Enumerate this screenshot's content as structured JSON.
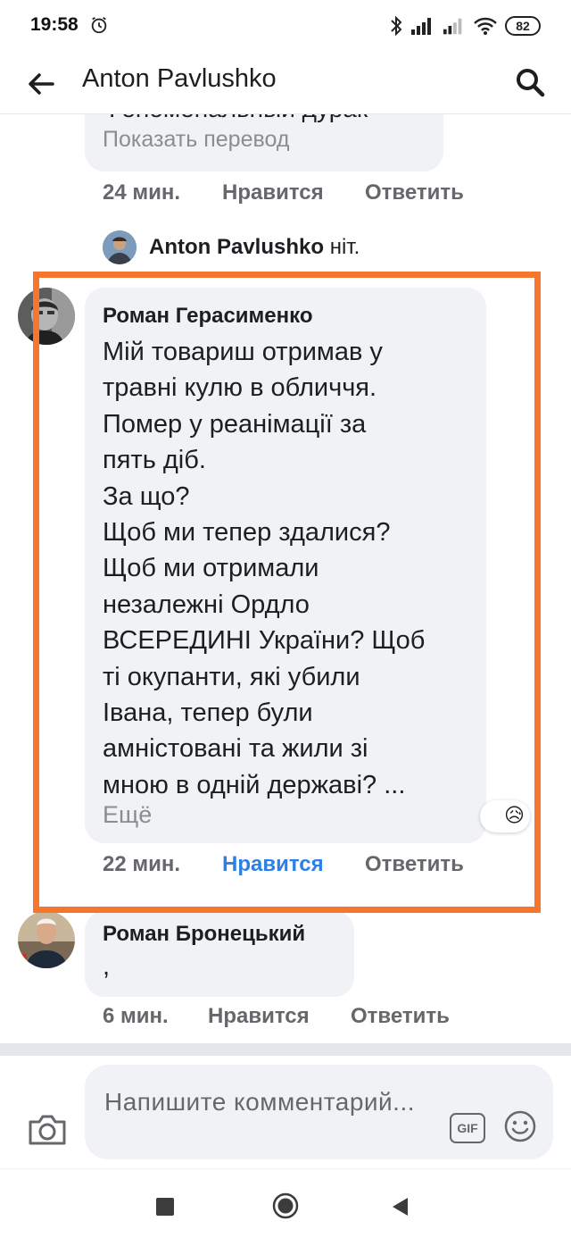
{
  "status_bar": {
    "time": "19:58",
    "battery": "82"
  },
  "app_bar": {
    "title": "Anton Pavlushko"
  },
  "comments": [
    {
      "text_partial": "Феноменальный дурак",
      "show_translation": "Показать перевод",
      "time": "24 мин.",
      "like": "Нравится",
      "reply": "Ответить"
    },
    {
      "reply_author": "Anton Pavlushko",
      "reply_text": "ніт."
    },
    {
      "author": "Роман Герасименко",
      "lines": [
        "Мій товариш отримав у",
        "травні кулю в обличчя.",
        "Помер у реанімації за",
        "пять діб.",
        "За що?",
        "Щоб ми тепер здалися?",
        "Щоб ми отримали",
        "незалежні Ордло",
        "ВСЕРЕДИНІ України?  Щоб",
        "ті окупанти, які убили",
        "Івана, тепер були",
        "амністовані та жили зі",
        "мною в одній державі? ..."
      ],
      "more": "Ещё",
      "reaction_emoji": "😥",
      "time": "22 мин.",
      "like": "Нравится",
      "reply": "Ответить"
    },
    {
      "author": "Роман Бронецький",
      "text": ",",
      "time": "6 мин.",
      "like": "Нравится",
      "reply": "Ответить"
    }
  ],
  "composer": {
    "placeholder": "Напишите комментарий...",
    "gif_label": "GIF"
  },
  "colors": {
    "highlight_border": "#f5772e",
    "liked_blue": "#2d7fe8",
    "bubble_bg": "#f0f2f5",
    "meta_gray": "#65676b"
  },
  "icons": [
    "alarm-icon",
    "bluetooth-icon",
    "signal-icon",
    "wifi-icon",
    "battery-icon",
    "back-arrow-icon",
    "search-icon",
    "camera-icon",
    "gif-icon",
    "emoji-icon",
    "nav-recents-icon",
    "nav-home-icon",
    "nav-back-icon"
  ]
}
